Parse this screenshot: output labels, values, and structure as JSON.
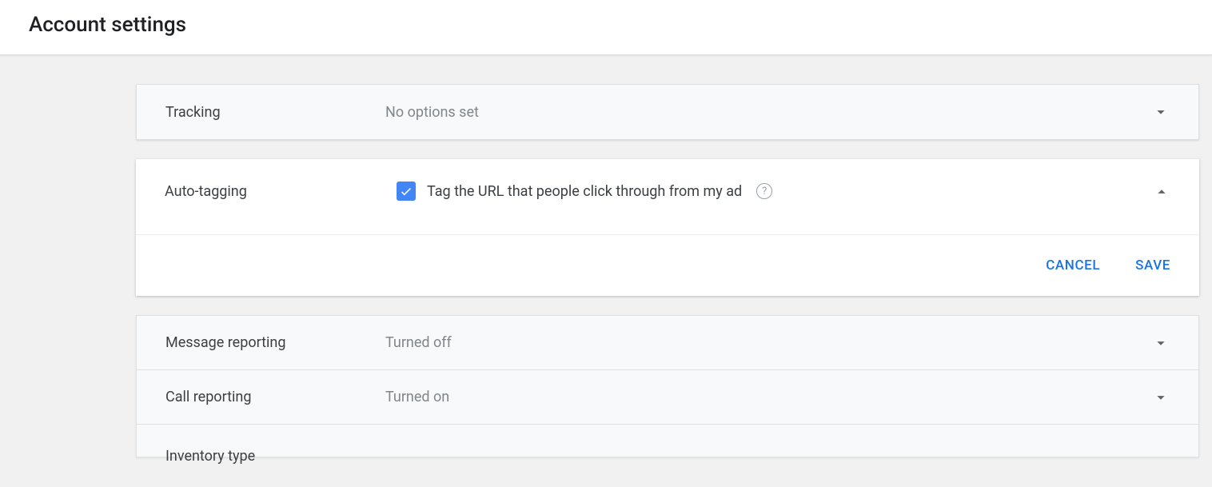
{
  "header": {
    "title": "Account settings"
  },
  "tracking": {
    "label": "Tracking",
    "value": "No options set"
  },
  "auto_tagging": {
    "label": "Auto-tagging",
    "checkbox_label": "Tag the URL that people click through from my ad",
    "cancel": "CANCEL",
    "save": "SAVE"
  },
  "rows": {
    "message_reporting": {
      "label": "Message reporting",
      "value": "Turned off"
    },
    "call_reporting": {
      "label": "Call reporting",
      "value": "Turned on"
    },
    "inventory_type": {
      "label": "Inventory type",
      "value": ""
    }
  }
}
